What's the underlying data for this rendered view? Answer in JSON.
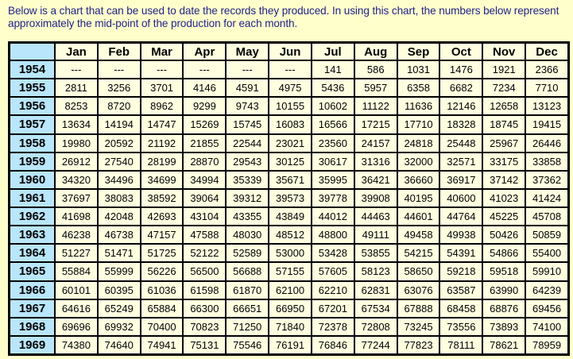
{
  "intro_text": "Below is a chart that can be used to date the records they produced. In using this chart, the numbers below represent approximately the mid-point of the production for each month.",
  "table": {
    "corner_label": "",
    "months": [
      "Jan",
      "Feb",
      "Mar",
      "Apr",
      "May",
      "Jun",
      "Jul",
      "Aug",
      "Sep",
      "Oct",
      "Nov",
      "Dec"
    ],
    "rows": [
      {
        "year": "1954",
        "cells": [
          "---",
          "---",
          "---",
          "---",
          "---",
          "---",
          "141",
          "586",
          "1031",
          "1476",
          "1921",
          "2366"
        ]
      },
      {
        "year": "1955",
        "cells": [
          "2811",
          "3256",
          "3701",
          "4146",
          "4591",
          "4975",
          "5436",
          "5957",
          "6358",
          "6682",
          "7234",
          "7710"
        ]
      },
      {
        "year": "1956",
        "cells": [
          "8253",
          "8720",
          "8962",
          "9299",
          "9743",
          "10155",
          "10602",
          "11122",
          "11636",
          "12146",
          "12658",
          "13123"
        ]
      },
      {
        "year": "1957",
        "cells": [
          "13634",
          "14194",
          "14747",
          "15269",
          "15745",
          "16083",
          "16566",
          "17215",
          "17710",
          "18328",
          "18745",
          "19415"
        ]
      },
      {
        "year": "1958",
        "cells": [
          "19980",
          "20592",
          "21192",
          "21855",
          "22544",
          "23021",
          "23560",
          "24157",
          "24818",
          "25448",
          "25967",
          "26446"
        ]
      },
      {
        "year": "1959",
        "cells": [
          "26912",
          "27540",
          "28199",
          "28870",
          "29543",
          "30125",
          "30617",
          "31316",
          "32000",
          "32571",
          "33175",
          "33858"
        ]
      },
      {
        "year": "1960",
        "cells": [
          "34320",
          "34496",
          "34699",
          "34994",
          "35339",
          "35671",
          "35995",
          "36421",
          "36660",
          "36917",
          "37142",
          "37362"
        ]
      },
      {
        "year": "1961",
        "cells": [
          "37697",
          "38083",
          "38592",
          "39064",
          "39312",
          "39573",
          "39778",
          "39908",
          "40195",
          "40600",
          "41023",
          "41424"
        ]
      },
      {
        "year": "1962",
        "cells": [
          "41698",
          "42048",
          "42693",
          "43104",
          "43355",
          "43849",
          "44012",
          "44463",
          "44601",
          "44764",
          "45225",
          "45708"
        ]
      },
      {
        "year": "1963",
        "cells": [
          "46238",
          "46738",
          "47157",
          "47588",
          "48030",
          "48512",
          "48800",
          "49111",
          "49458",
          "49938",
          "50426",
          "50859"
        ]
      },
      {
        "year": "1964",
        "cells": [
          "51227",
          "51471",
          "51725",
          "52122",
          "52589",
          "53000",
          "53428",
          "53855",
          "54215",
          "54391",
          "54866",
          "55400"
        ]
      },
      {
        "year": "1965",
        "cells": [
          "55884",
          "55999",
          "56226",
          "56500",
          "56688",
          "57155",
          "57605",
          "58123",
          "58650",
          "59218",
          "59518",
          "59910"
        ]
      },
      {
        "year": "1966",
        "cells": [
          "60101",
          "60395",
          "61036",
          "61598",
          "61870",
          "62100",
          "62210",
          "62831",
          "63076",
          "63587",
          "63990",
          "64239"
        ]
      },
      {
        "year": "1967",
        "cells": [
          "64616",
          "65249",
          "65884",
          "66300",
          "66651",
          "66950",
          "67201",
          "67534",
          "67888",
          "68458",
          "68876",
          "69456"
        ]
      },
      {
        "year": "1968",
        "cells": [
          "69696",
          "69932",
          "70400",
          "70823",
          "71250",
          "71840",
          "72378",
          "72808",
          "73245",
          "73556",
          "73893",
          "74100"
        ]
      },
      {
        "year": "1969",
        "cells": [
          "74380",
          "74640",
          "74941",
          "75131",
          "75546",
          "76191",
          "76846",
          "77244",
          "77823",
          "78111",
          "78621",
          "78959"
        ]
      }
    ]
  },
  "colors": {
    "page_background": "#FFFFCC",
    "cell_background": "#FFFFE0",
    "year_header_background": "#B9E6FA",
    "grid_lines": "#000000",
    "intro_text": "#22228a"
  }
}
